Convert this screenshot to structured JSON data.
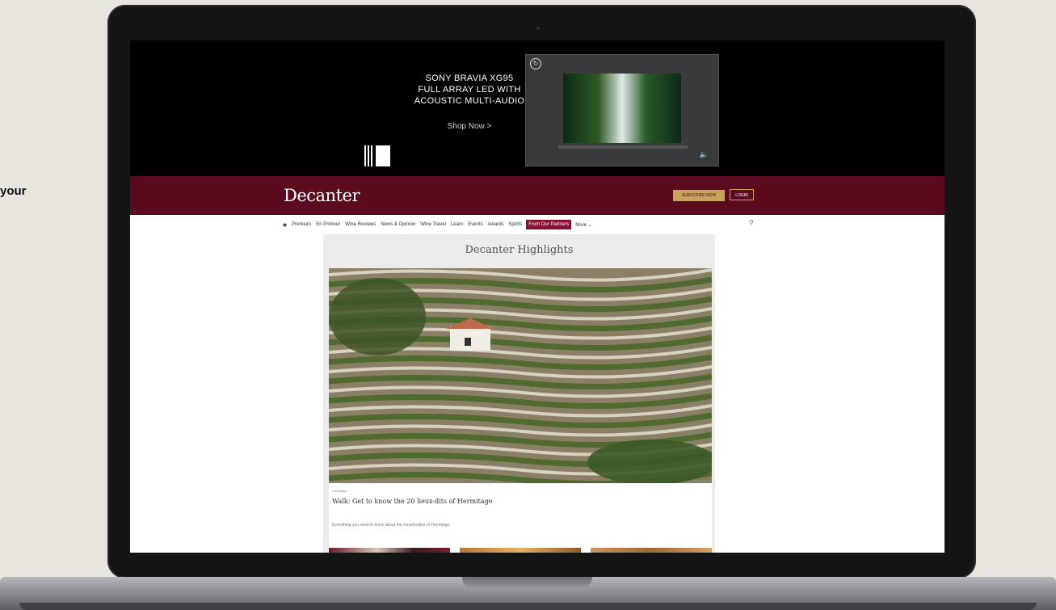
{
  "side_text": "your",
  "ad": {
    "headline_lines": [
      "SONY BRAVIA XG95",
      "FULL ARRAY LED WITH",
      "ACOUSTIC MULTI-AUDIO"
    ],
    "cta": "Shop Now >"
  },
  "header": {
    "logo": "Decanter",
    "subscribe_label": "SUBSCRIBE NOW",
    "login_label": "LOGIN",
    "brand_color": "#5c0b1e",
    "accent_color": "#c9a25f"
  },
  "nav": {
    "items": [
      "Premium",
      "En Primeur",
      "Wine Reviews",
      "News & Opinion",
      "Wine Travel",
      "Learn",
      "Events",
      "Awards",
      "Spirits",
      "From Our Partners",
      "More ⌄"
    ],
    "active_item": "From Our Partners",
    "active_color": "#8b0e33"
  },
  "highlights": {
    "title": "Decanter Highlights",
    "category": "Hermitage",
    "headline": "Walk: Get to know the 20 lieux-dits of Hermitage",
    "description": "Everything you need to know about the complexities of Hermitage."
  },
  "icons": {
    "nav_home": "star-icon",
    "search": "search-icon",
    "ad_replay": "replay-icon",
    "ad_mute": "mute-icon"
  }
}
